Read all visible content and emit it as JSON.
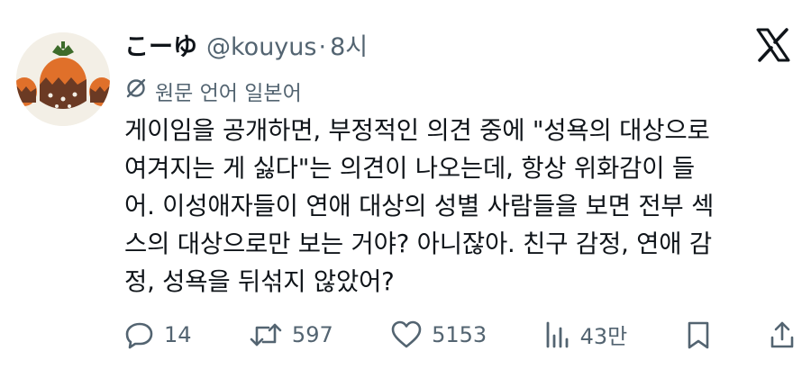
{
  "user": {
    "display_name": "こーゆ",
    "handle": "@kouyus",
    "separator": "·",
    "time": "8시"
  },
  "translate": {
    "label": "원문 언어 일본어"
  },
  "tweet": {
    "lines": [
      "게이임을 공개하면, 부정적인 의견 중에 \"성욕의 대상으로",
      "여겨지는 게 싫다\"는 의견이 나오는데, 항상 위화감이 들",
      "어. 이성애자들이 연애 대상의 성별 사람들을 보면 전부 섹",
      "스의 대상으로만 보는 거야? 아니잖아. 친구 감정, 연애 감",
      "정, 성욕을 뒤섞지 않았어?"
    ]
  },
  "actions": {
    "replies": "14",
    "reposts": "597",
    "likes": "5153",
    "views": "43만"
  },
  "icons": {
    "platform": "x-logo-icon",
    "translate": "translate-icon",
    "reply": "reply-icon",
    "repost": "repost-icon",
    "like": "heart-icon",
    "views": "views-icon",
    "bookmark": "bookmark-icon",
    "share": "share-icon"
  },
  "colors": {
    "text": "#0f1419",
    "secondary": "#536471",
    "avatar_bg": "#f3efe6",
    "persimmon_orange": "#e0702a",
    "persimmon_brown": "#6b3a24",
    "leaf_green": "#3d6b2a"
  }
}
